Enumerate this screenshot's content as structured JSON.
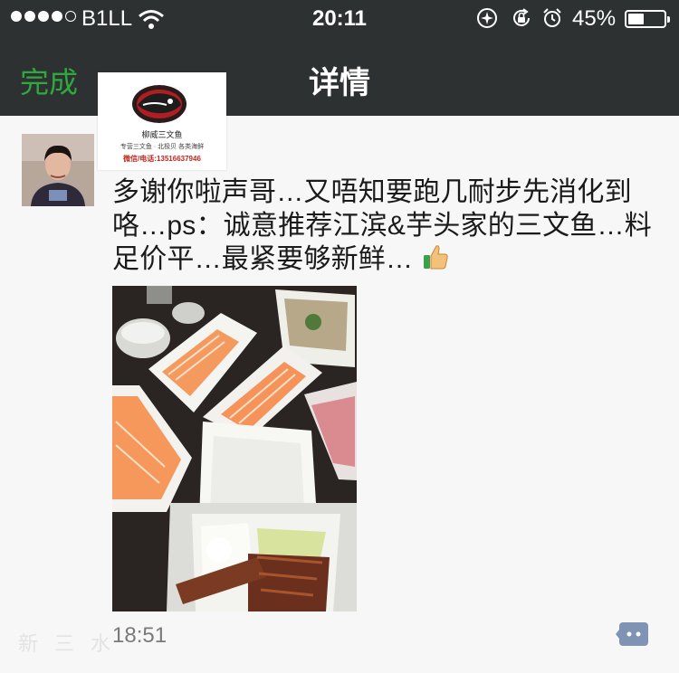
{
  "status_bar": {
    "carrier": "B1LL",
    "time": "20:11",
    "battery_percent": "45%",
    "battery_level": 0.45,
    "signal_dots_filled": 4,
    "signal_dots_total": 5
  },
  "nav": {
    "done_label": "完成",
    "title": "详情"
  },
  "logo_card": {
    "brand": "柳威三文鱼",
    "tagline": "专营三文鱼 · 北极贝 各类海鲜",
    "phone": "微信/电话:13516637946"
  },
  "post": {
    "text": "多谢你啦声哥…又唔知要跑几耐步先消化到咯…ps：诚意推荐江滨&芋头家的三文鱼…料足价平…最紧要够新鲜…",
    "emoji": "thumbs-up-icon",
    "time": "18:51"
  },
  "watermark": "新三水",
  "colors": {
    "bar_bg": "#2e3132",
    "done_green": "#2fa840",
    "comment_blue": "#7f94b4",
    "phone_red": "#c2271e"
  }
}
